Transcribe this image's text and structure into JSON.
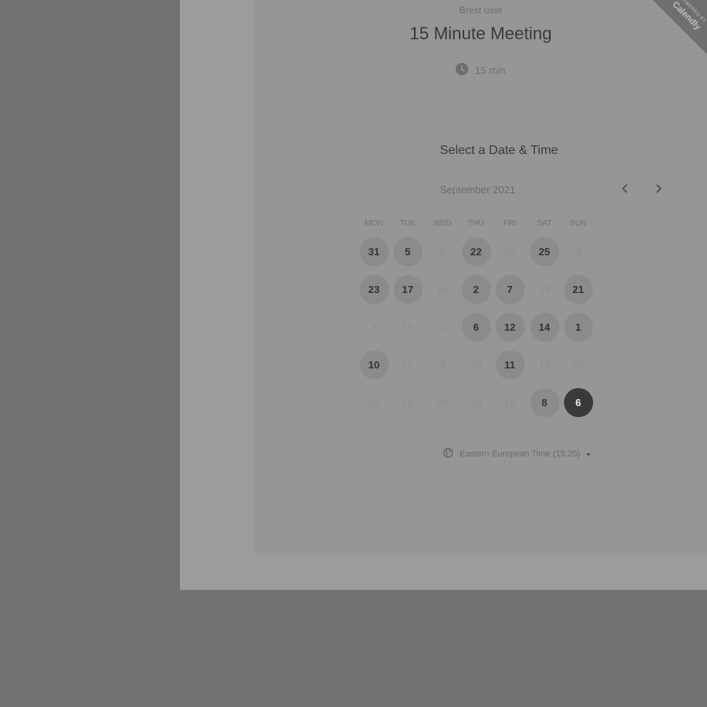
{
  "header": {
    "host_name": "Brest user",
    "event_title": "15 Minute Meeting",
    "duration": "15 min"
  },
  "ribbon": {
    "line1": "POWERED BY",
    "line2": "Calendly"
  },
  "calendar": {
    "heading": "Select a Date & Time",
    "month_label": "September 2021",
    "weekdays": [
      "MON",
      "TUE",
      "WED",
      "THU",
      "FRI",
      "SAT",
      "SUN"
    ],
    "rows": [
      [
        {
          "d": "31",
          "s": "avail"
        },
        {
          "d": "5",
          "s": "avail"
        },
        {
          "d": "9",
          "s": "unavail"
        },
        {
          "d": "22",
          "s": "avail"
        },
        {
          "d": "26",
          "s": "unavail"
        },
        {
          "d": "25",
          "s": "avail"
        },
        {
          "d": "4",
          "s": "unavail"
        }
      ],
      [
        {
          "d": "23",
          "s": "avail"
        },
        {
          "d": "17",
          "s": "avail"
        },
        {
          "d": "16",
          "s": "unavail"
        },
        {
          "d": "2",
          "s": "avail"
        },
        {
          "d": "7",
          "s": "avail"
        },
        {
          "d": "18",
          "s": "unavail"
        },
        {
          "d": "21",
          "s": "avail"
        }
      ],
      [
        {
          "d": "3",
          "s": "unavail"
        },
        {
          "d": "15",
          "s": "unavail"
        },
        {
          "d": "11",
          "s": "unavail"
        },
        {
          "d": "6",
          "s": "avail"
        },
        {
          "d": "12",
          "s": "avail"
        },
        {
          "d": "14",
          "s": "avail"
        },
        {
          "d": "1",
          "s": "avail"
        }
      ],
      [
        {
          "d": "10",
          "s": "avail"
        },
        {
          "d": "27",
          "s": "unavail"
        },
        {
          "d": "4",
          "s": "unavail"
        },
        {
          "d": "28",
          "s": "unavail"
        },
        {
          "d": "11",
          "s": "avail"
        },
        {
          "d": "15",
          "s": "unavail"
        },
        {
          "d": "27",
          "s": "unavail"
        }
      ],
      [
        {
          "d": "30",
          "s": "unavail"
        },
        {
          "d": "19",
          "s": "unavail"
        },
        {
          "d": "29",
          "s": "unavail"
        },
        {
          "d": "30",
          "s": "unavail"
        },
        {
          "d": "10",
          "s": "unavail"
        },
        {
          "d": "8",
          "s": "avail"
        },
        {
          "d": "6",
          "s": "selected"
        }
      ]
    ]
  },
  "timezone": {
    "label": "Eastern European Time (15:25)"
  },
  "icons": {
    "clock": "clock-icon",
    "prev": "chevron-left-icon",
    "next": "chevron-right-icon",
    "globe": "globe-icon",
    "caret": "caret-down-icon"
  }
}
